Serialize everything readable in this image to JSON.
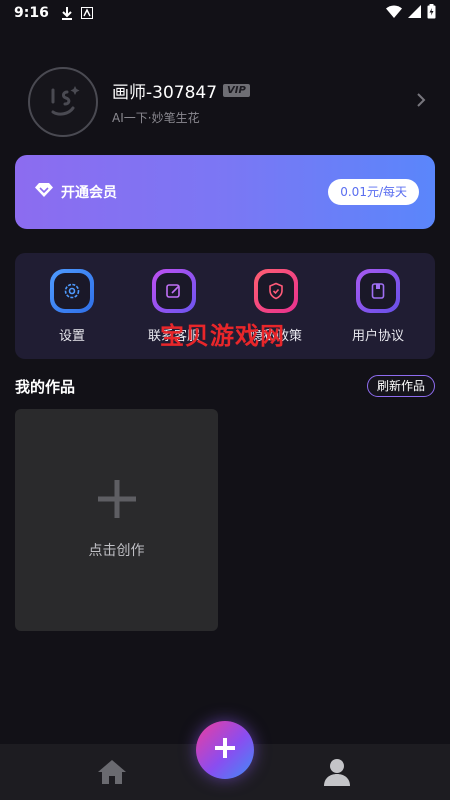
{
  "status_bar": {
    "time": "9:16",
    "icons": [
      "download-icon",
      "a-icon",
      "wifi-icon",
      "signal-icon",
      "battery-icon"
    ]
  },
  "profile": {
    "nickname": "画师-307847",
    "vip_badge": "VIP",
    "slogan": "AI一下·妙笔生花",
    "avatar_icon": "wink-face-icon",
    "arrow_icon": "chevron-right-icon"
  },
  "vip_banner": {
    "label": "开通会员",
    "price": "0.01元/每天",
    "icon": "diamond-icon",
    "gradient": [
      "#8c6cf0",
      "#5a86fb"
    ]
  },
  "menu": {
    "items": [
      {
        "label": "设置",
        "icon": "settings-icon",
        "color": "#3d8cf5"
      },
      {
        "label": "联系客服",
        "icon": "edit-icon",
        "color": "#9b55f0"
      },
      {
        "label": "隐私政策",
        "icon": "shield-icon",
        "color": "#f04560"
      },
      {
        "label": "用户协议",
        "icon": "document-icon",
        "color": "#8a55f0"
      }
    ]
  },
  "watermark": "宝贝游戏网",
  "works": {
    "title": "我的作品",
    "refresh_label": "刷新作品",
    "create_label": "点击创作",
    "create_icon": "plus-icon"
  },
  "bottom_nav": {
    "home_icon": "home-icon",
    "fab_icon": "plus-icon",
    "user_icon": "user-icon"
  },
  "colors": {
    "background": "#121117",
    "accent": "#8e6cf0",
    "card": "#201d33"
  }
}
